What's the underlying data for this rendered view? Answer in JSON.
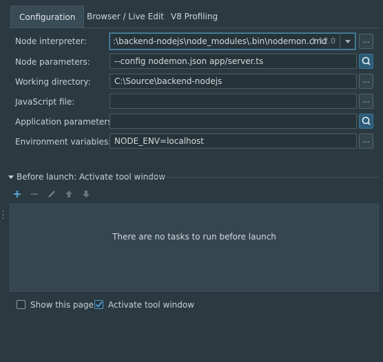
{
  "tabs": [
    {
      "label": "Configuration"
    },
    {
      "label": "Browser / Live Edit"
    },
    {
      "label": "V8 Profiling"
    }
  ],
  "form": {
    "node_interpreter": {
      "label": "Node interpreter:",
      "value": ":\\backend-nodejs\\node_modules\\.bin\\nodemon.cmd",
      "version": "1.12.0"
    },
    "node_parameters": {
      "label": "Node parameters:",
      "value": "--config nodemon.json app/server.ts"
    },
    "working_directory": {
      "label": "Working directory:",
      "value": "C:\\Source\\backend-nodejs"
    },
    "javascript_file": {
      "label": "JavaScript file:",
      "value": ""
    },
    "application_parameters": {
      "label": "Application parameters:",
      "value": ""
    },
    "environment_variables": {
      "label": "Environment variables:",
      "value": "NODE_ENV=localhost"
    },
    "browse_label": "..."
  },
  "before_launch": {
    "title": "Before launch: Activate tool window",
    "empty_message": "There are no tasks to run before launch",
    "toolbar_icons": [
      "add-icon",
      "remove-icon",
      "edit-icon",
      "move-up-icon",
      "move-down-icon"
    ]
  },
  "options": {
    "show_page": {
      "label": "Show this page",
      "checked": false
    },
    "activate_tool_window": {
      "label": "Activate tool window",
      "checked": true
    }
  },
  "colors": {
    "background": "#2b3940",
    "field_bg": "#26343a",
    "accent": "#4f87a6",
    "add_icon": "#5aa6d6",
    "checkbox_check": "#4f9bd0"
  }
}
